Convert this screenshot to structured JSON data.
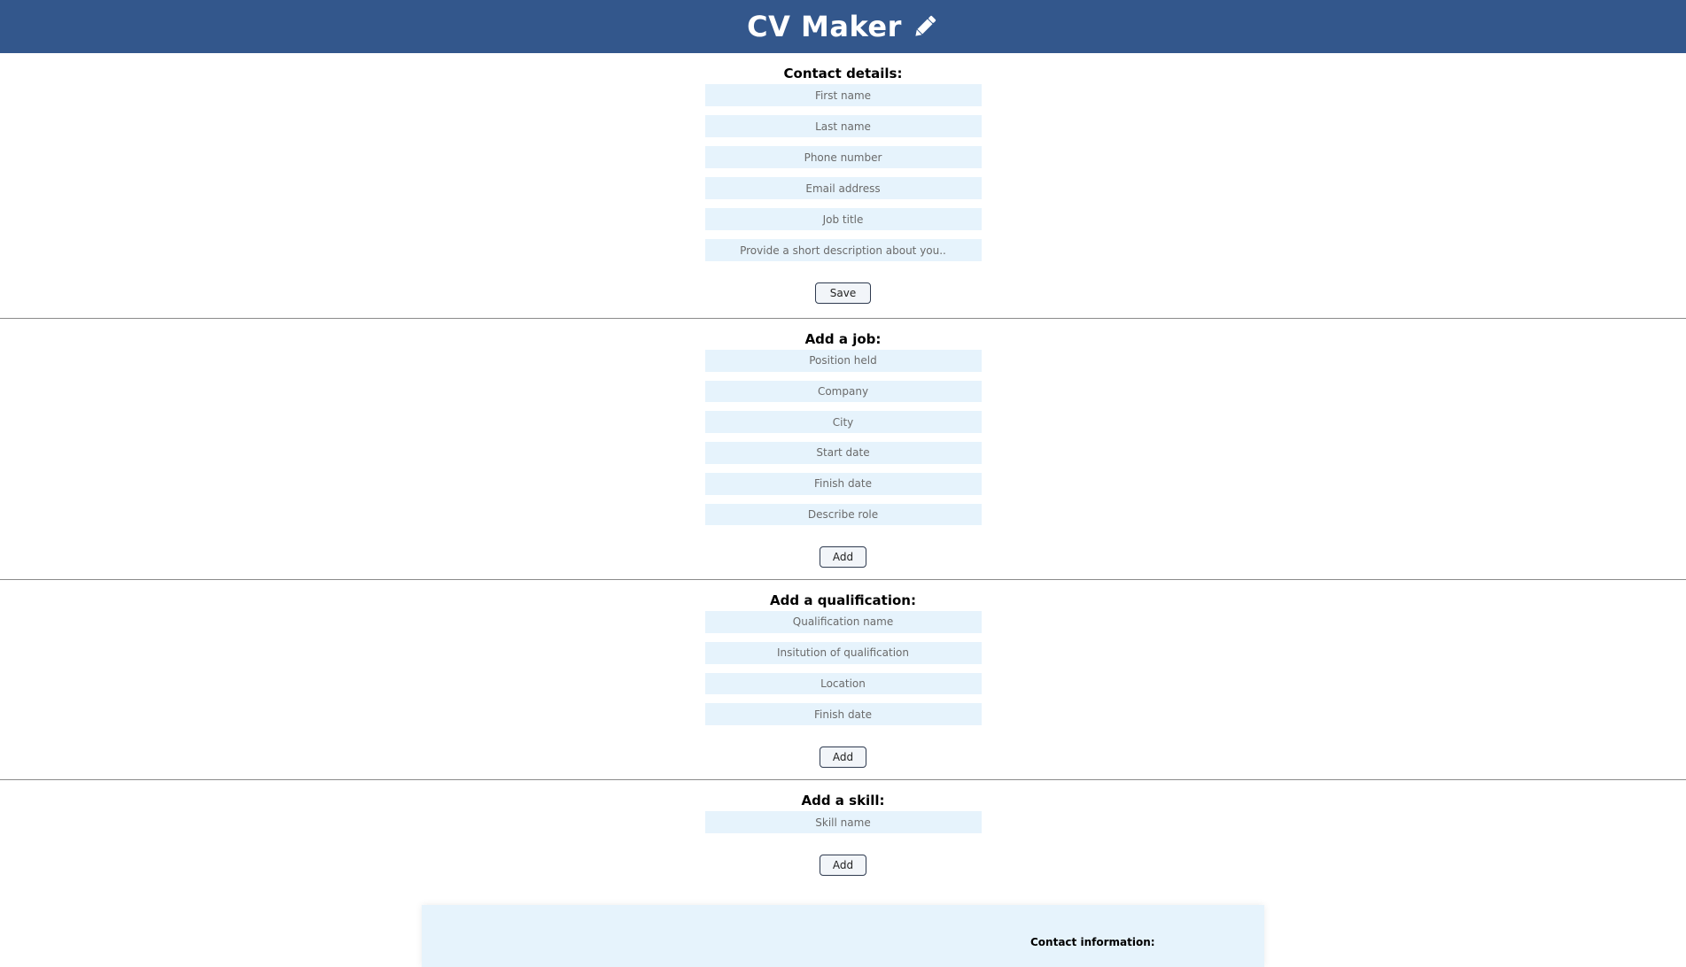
{
  "header": {
    "title": "CV Maker",
    "icon": "pencil-icon"
  },
  "contact": {
    "title": "Contact details:",
    "fields": {
      "first_name": "First name",
      "last_name": "Last name",
      "phone": "Phone number",
      "email": "Email address",
      "job_title": "Job title",
      "description": "Provide a short description about you.."
    },
    "button": "Save"
  },
  "job": {
    "title": "Add a job:",
    "fields": {
      "position": "Position held",
      "company": "Company",
      "city": "City",
      "start": "Start date",
      "finish": "Finish date",
      "role": "Describe role"
    },
    "button": "Add"
  },
  "qualification": {
    "title": "Add a qualification:",
    "fields": {
      "name": "Qualification name",
      "institution": "Insitution of qualification",
      "location": "Location",
      "finish": "Finish date"
    },
    "button": "Add"
  },
  "skill": {
    "title": "Add a skill:",
    "fields": {
      "name": "Skill name"
    },
    "button": "Add"
  },
  "preview": {
    "contact_title": "Contact information:"
  },
  "colors": {
    "header_bg": "#33578c",
    "field_bg": "#e6f3fc"
  }
}
